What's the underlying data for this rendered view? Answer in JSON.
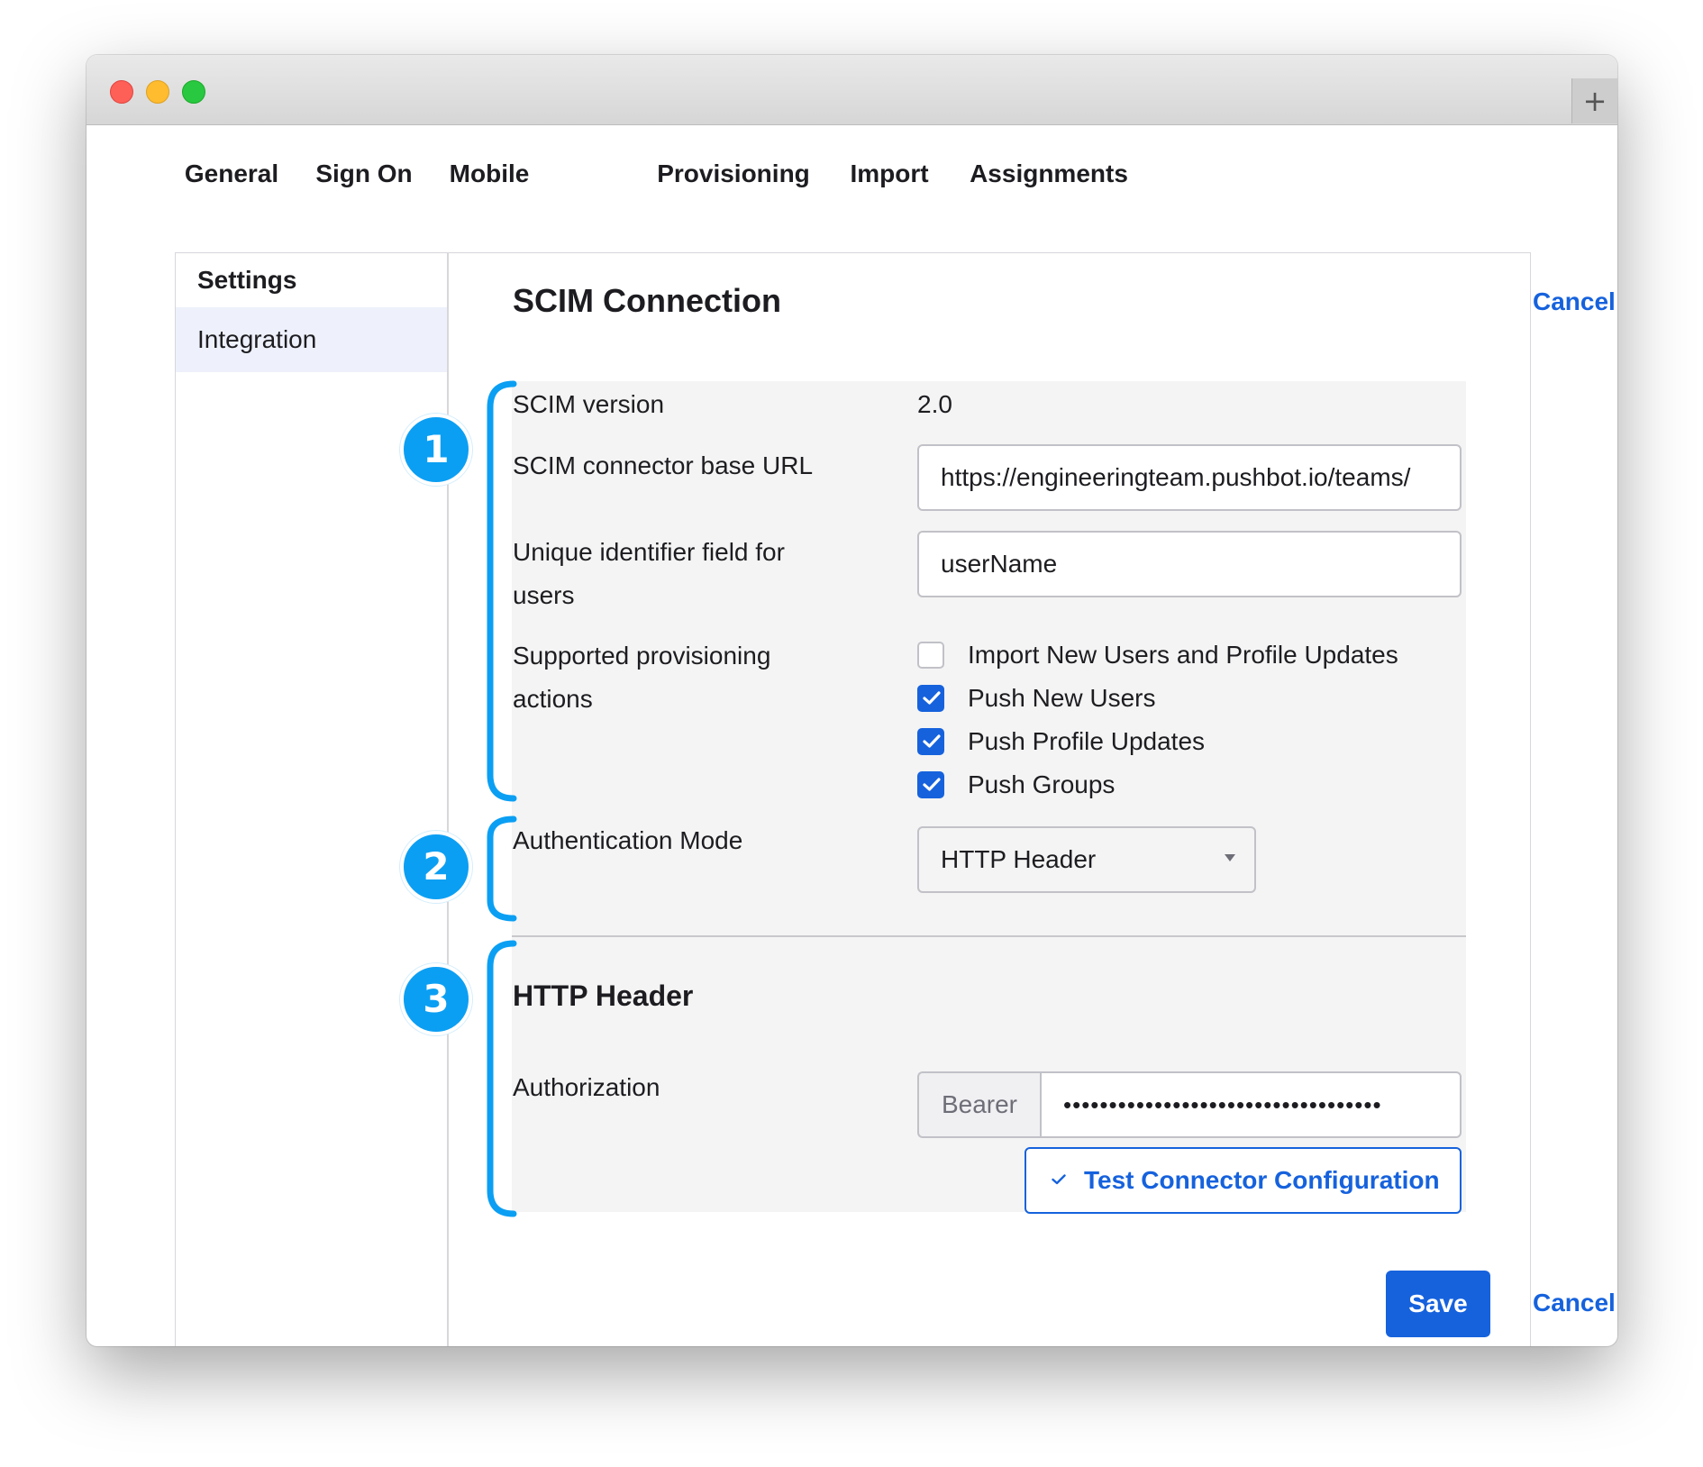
{
  "window": {
    "new_tab_glyph": "+"
  },
  "tabs": [
    {
      "label": "General"
    },
    {
      "label": "Sign On"
    },
    {
      "label": "Mobile"
    },
    {
      "label": "Provisioning"
    },
    {
      "label": "Import"
    },
    {
      "label": "Assignments"
    }
  ],
  "active_tab": "Provisioning",
  "sidebar": {
    "heading": "Settings",
    "items": [
      {
        "label": "Integration"
      }
    ]
  },
  "scim": {
    "title": "SCIM Connection",
    "cancel_top": "Cancel",
    "version_label": "SCIM version",
    "version_value": "2.0",
    "base_url_label": "SCIM connector base URL",
    "base_url_value": "https://engineeringteam.pushbot.io/teams/",
    "unique_id_label": "Unique identifier field for users",
    "unique_id_value": "userName",
    "actions_label": "Supported provisioning actions",
    "actions": [
      {
        "label": "Import New Users and Profile Updates",
        "checked": false
      },
      {
        "label": "Push New Users",
        "checked": true
      },
      {
        "label": "Push Profile Updates",
        "checked": true
      },
      {
        "label": "Push Groups",
        "checked": true
      }
    ],
    "auth_mode_label": "Authentication Mode",
    "auth_mode_value": "HTTP Header"
  },
  "http_header": {
    "title": "HTTP Header",
    "authorization_label": "Authorization",
    "bearer_prefix": "Bearer",
    "token_masked": "•••••••••••••••••••••••••••••••••••",
    "test_button": "Test Connector Configuration"
  },
  "footer": {
    "save": "Save",
    "cancel": "Cancel"
  },
  "callouts": [
    "1",
    "2",
    "3"
  ],
  "colors": {
    "accent": "#1662dd",
    "callout": "#0b9ff3",
    "section_bg": "#f4f4f4"
  },
  "icons": {
    "checkbox_check": "check-icon",
    "select_caret": "chevron-down-icon",
    "test_check": "check-icon"
  }
}
